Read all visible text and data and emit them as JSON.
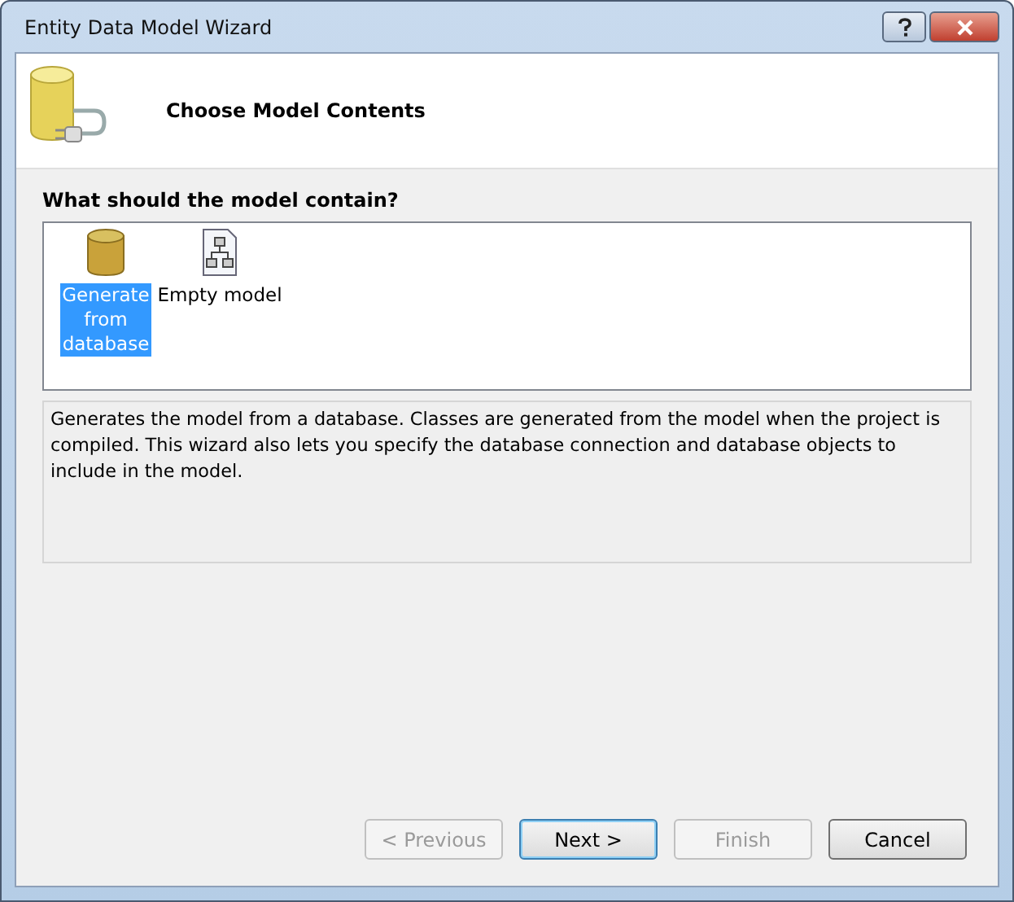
{
  "window": {
    "title": "Entity Data Model Wizard"
  },
  "header": {
    "title": "Choose Model Contents"
  },
  "prompt": "What should the model contain?",
  "options": [
    {
      "kind": "database",
      "label": "Generate from database",
      "selected": true
    },
    {
      "kind": "empty",
      "label": "Empty model",
      "selected": false
    }
  ],
  "description": "Generates the model from a database. Classes are generated from the model when the project is compiled. This wizard also lets you specify the database connection and database objects to include in the model.",
  "buttons": [
    {
      "label": "< Previous",
      "disabled": true,
      "default": false
    },
    {
      "label": "Next >",
      "disabled": false,
      "default": true
    },
    {
      "label": "Finish",
      "disabled": true,
      "default": false
    },
    {
      "label": "Cancel",
      "disabled": false,
      "default": false
    }
  ]
}
